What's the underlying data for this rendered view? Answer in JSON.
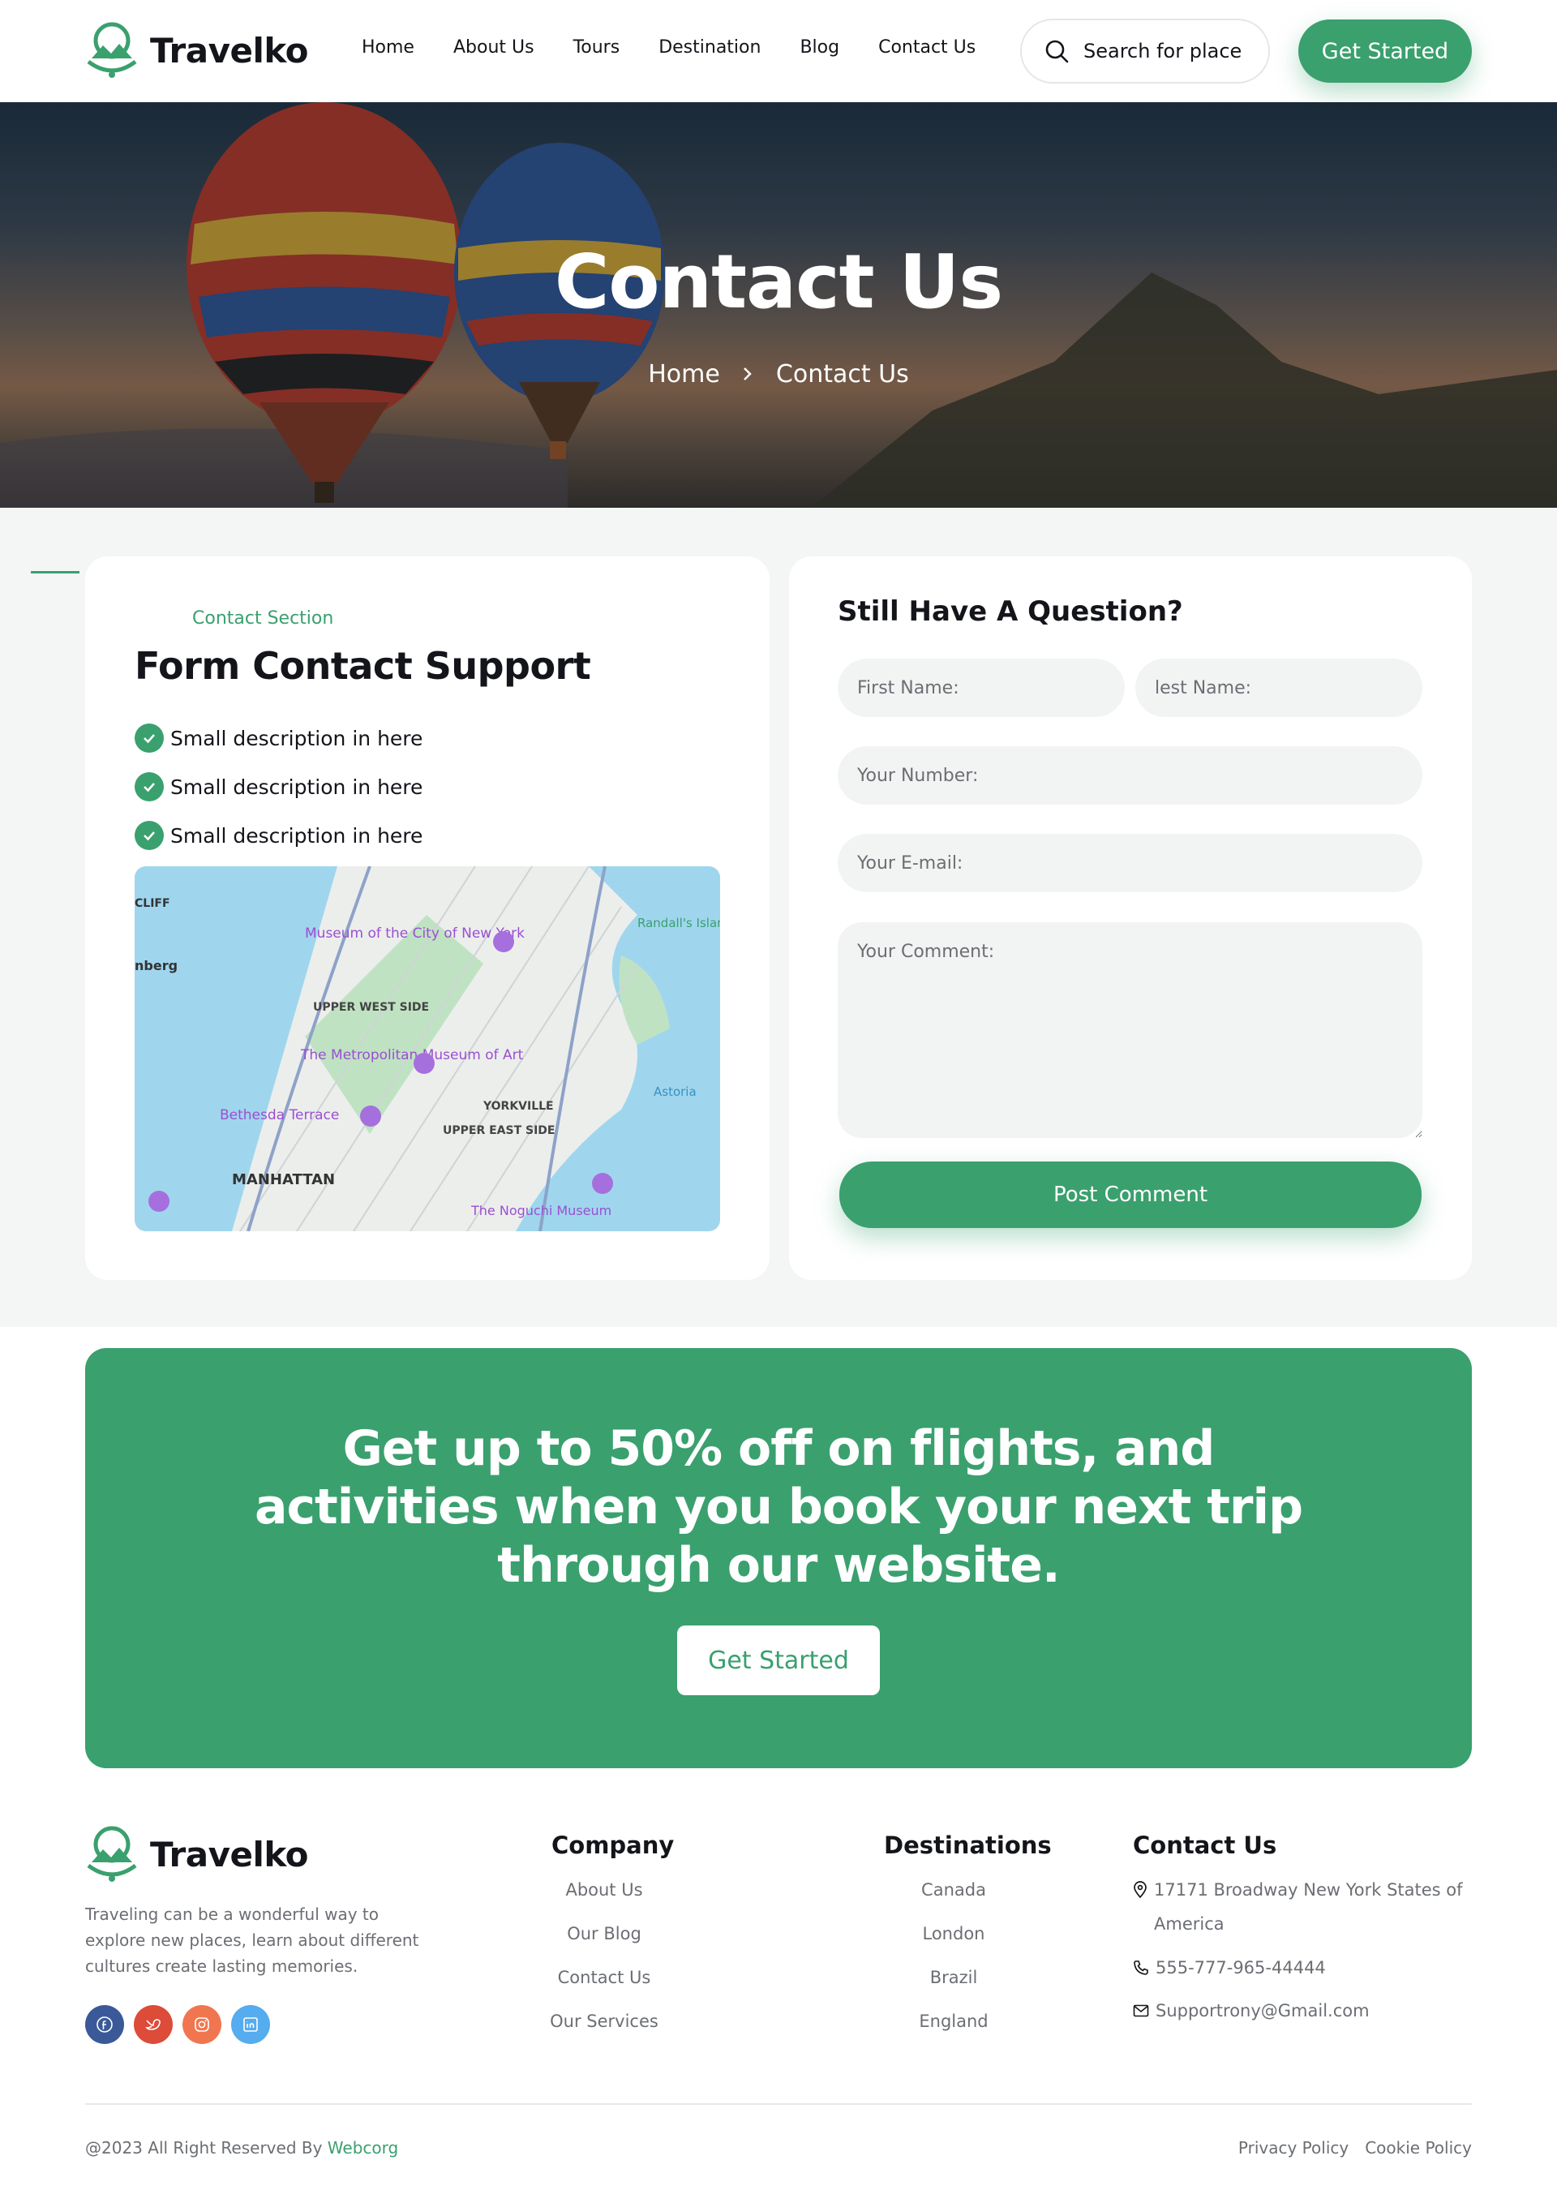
{
  "brand": {
    "name": "Travelko"
  },
  "nav": {
    "items": [
      "Home",
      "About Us",
      "Tours",
      "Destination",
      "Blog",
      "Contact Us"
    ],
    "search_label": "Search for place",
    "cta_label": "Get Started"
  },
  "hero": {
    "title": "Contact Us",
    "breadcrumb": {
      "home": "Home",
      "current": "Contact Us"
    }
  },
  "contact": {
    "kicker": "Contact Section",
    "title": "Form Contact Support",
    "checks": [
      "Small description in here",
      "Small description in here",
      "Small description in here"
    ],
    "map_labels": [
      "Museum of the City of New York",
      "The Metropolitan Museum of Art",
      "Bethesda Terrace",
      "UPPER WEST SIDE",
      "UPPER EAST SIDE",
      "YORKVILLE",
      "MANHATTAN",
      "The Noguchi Museum",
      "Astoria",
      "Randall's Island"
    ]
  },
  "form": {
    "title": "Still Have A Question?",
    "first_name": "First Name:",
    "last_name": "lest Name:",
    "number": "Your Number:",
    "email": "Your E-mail:",
    "comment": "Your Comment:",
    "submit": "Post Comment"
  },
  "promo": {
    "line1": "Get up to 50% off on flights, and",
    "line2": "activities when you book your next trip",
    "line3": "through our website.",
    "cta": "Get Started"
  },
  "footer": {
    "description": "Traveling can be a wonderful way to explore new places, learn about different cultures create lasting memories.",
    "socials": [
      "facebook-icon",
      "twitter-icon",
      "instagram-icon",
      "linkedin-icon"
    ],
    "company": {
      "heading": "Company",
      "links": [
        "About Us",
        "Our Blog",
        "Contact Us",
        "Our Services"
      ]
    },
    "destinations": {
      "heading": "Destinations",
      "links": [
        "Canada",
        "London",
        "Brazil",
        "England"
      ]
    },
    "contact": {
      "heading": "Contact Us",
      "address_1": "17171 Broadway New York States of",
      "address_2": "America",
      "phone": "555-777-965-44444",
      "email": "Supportrony@Gmail.com"
    },
    "copyright": "@2023 All Right Reserved By",
    "copyright_brand": "Webcorg",
    "legal": [
      "Privacy Policy",
      "Cookie Policy"
    ]
  },
  "colors": {
    "accent": "#3aa06e",
    "text": "#14151a",
    "muted": "#6b6e73",
    "section_bg": "#f4f6f5"
  }
}
